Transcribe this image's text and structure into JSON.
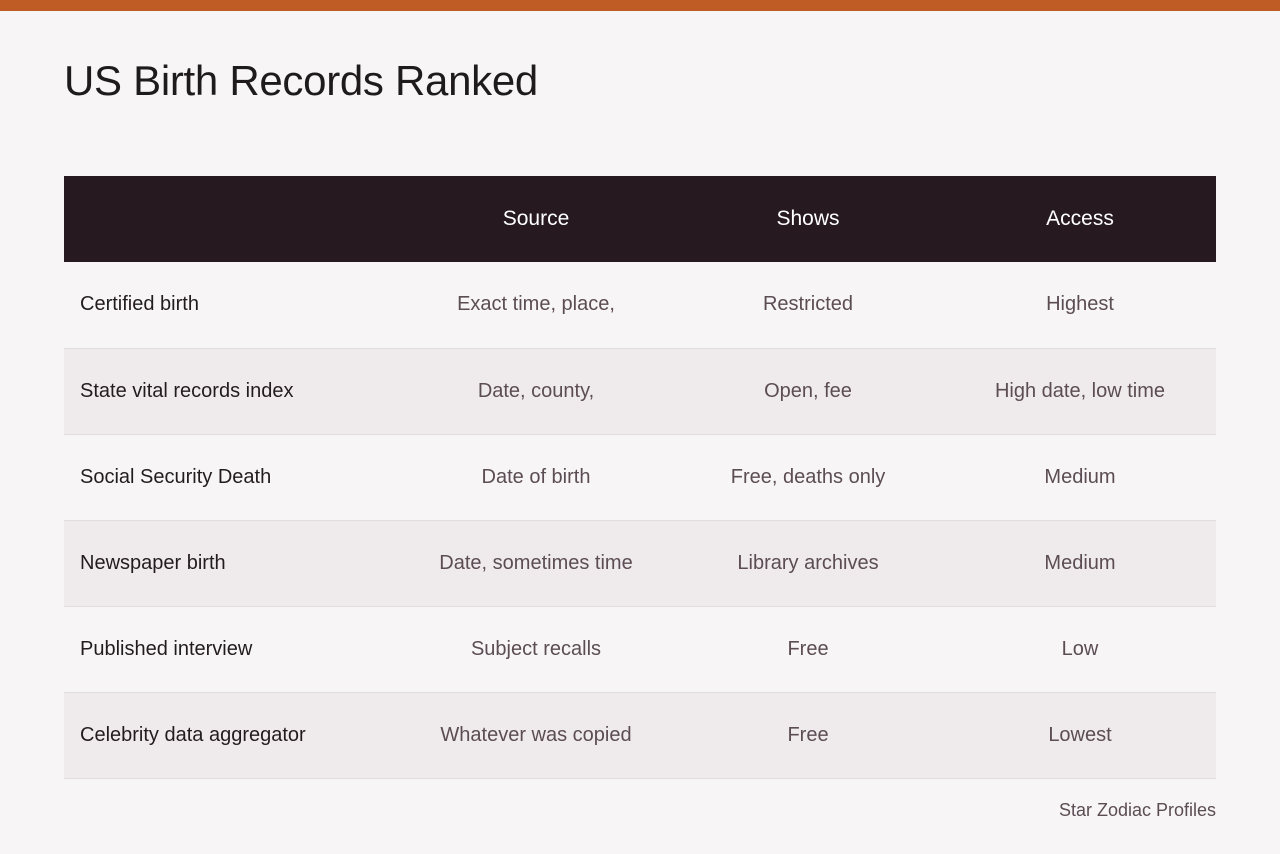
{
  "title": "US Birth Records Ranked",
  "colors": {
    "accent_bar": "#bf5b24",
    "header_bg": "#261a20",
    "page_bg": "#f7f5f6",
    "stripe_bg": "#efebec"
  },
  "table": {
    "headers": [
      "",
      "Source",
      "Shows",
      "Access"
    ],
    "rows": [
      [
        "Certified birth",
        "Exact time, place,",
        "Restricted",
        "Highest"
      ],
      [
        "State vital records index",
        "Date, county,",
        "Open, fee",
        "High date, low time"
      ],
      [
        "Social Security Death",
        "Date of birth",
        "Free, deaths only",
        "Medium"
      ],
      [
        "Newspaper birth",
        "Date, sometimes time",
        "Library archives",
        "Medium"
      ],
      [
        "Published interview",
        "Subject recalls",
        "Free",
        "Low"
      ],
      [
        "Celebrity data aggregator",
        "Whatever was copied",
        "Free",
        "Lowest"
      ]
    ]
  },
  "credit": "Star Zodiac Profiles"
}
